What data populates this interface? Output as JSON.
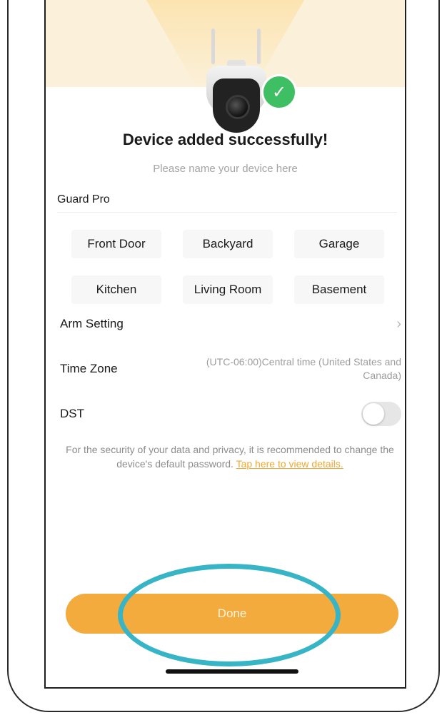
{
  "header": {
    "title": "Device added successfully!",
    "subtitle": "Please name your device here"
  },
  "device_name": {
    "value": "Guard Pro"
  },
  "name_suggestions": [
    {
      "label": "Front Door"
    },
    {
      "label": "Backyard"
    },
    {
      "label": "Garage"
    },
    {
      "label": "Kitchen"
    },
    {
      "label": "Living Room"
    },
    {
      "label": "Basement"
    }
  ],
  "settings": {
    "arm_setting": {
      "label": "Arm Setting",
      "icon": "chevron-right-icon"
    },
    "time_zone": {
      "label": "Time Zone",
      "value": "(UTC-06:00)Central time (United States and Canada)"
    },
    "dst": {
      "label": "DST",
      "enabled": false
    }
  },
  "security_note": {
    "text": "For the security of your data and privacy, it is recommended to change the device's default password.",
    "link": "Tap here to view details."
  },
  "actions": {
    "done": "Done"
  },
  "colors": {
    "accent": "#f2ab3c",
    "success": "#3fbf64",
    "highlight": "#37b5c7",
    "link": "#f0a831"
  },
  "icons": {
    "success": "checkmark-icon",
    "device": "security-camera-image"
  }
}
